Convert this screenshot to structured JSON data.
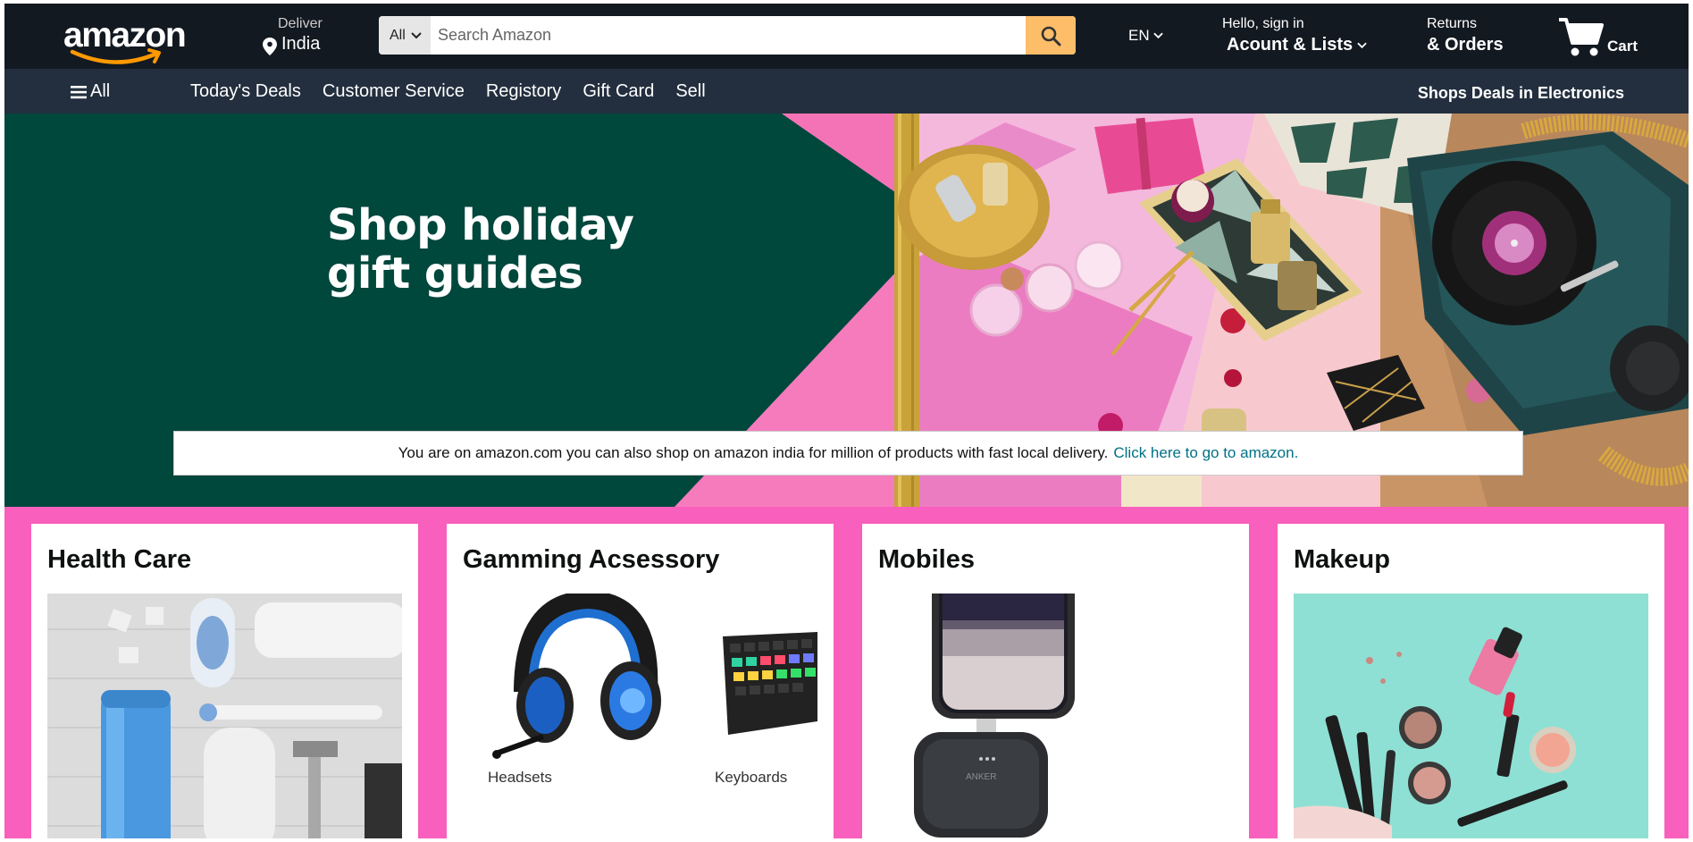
{
  "header": {
    "logo_text": "amazon",
    "deliver_label": "Deliver",
    "deliver_location": "India",
    "search_category": "All",
    "search_placeholder": "Search Amazon",
    "language": "EN",
    "account_greeting": "Hello, sign in",
    "account_label": "Acount & Lists",
    "returns_label": "Returns",
    "orders_label": "& Orders",
    "cart_label": "Cart"
  },
  "subnav": {
    "all_label": "All",
    "links": [
      "Today's Deals",
      "Customer Service",
      "Registory",
      "Gift Card",
      "Sell"
    ],
    "promo": "Shops Deals in Electronics"
  },
  "hero": {
    "title_line1": "Shop holiday",
    "title_line2": "gift guides",
    "notice_text": "You are on amazon.com you can also shop on amazon india for million of products with fast local delivery.",
    "notice_link": "Click here to go to amazon."
  },
  "cards": [
    {
      "title": "Health Care"
    },
    {
      "title": "Gamming Acsessory",
      "sub_items": [
        "Headsets",
        "Keyboards"
      ]
    },
    {
      "title": "Mobiles"
    },
    {
      "title": "Makeup"
    }
  ],
  "colors": {
    "nav_dark": "#131921",
    "nav_sub": "#232f3e",
    "search_button": "#febd69",
    "hero_green": "#00473c",
    "hero_pink": "#f57bbd",
    "cards_bg": "#f95fbc",
    "link": "#007185",
    "accent": "#ff9900"
  },
  "icons": [
    "location-pin-icon",
    "chevron-down-icon",
    "search-icon",
    "cart-icon",
    "hamburger-icon"
  ]
}
